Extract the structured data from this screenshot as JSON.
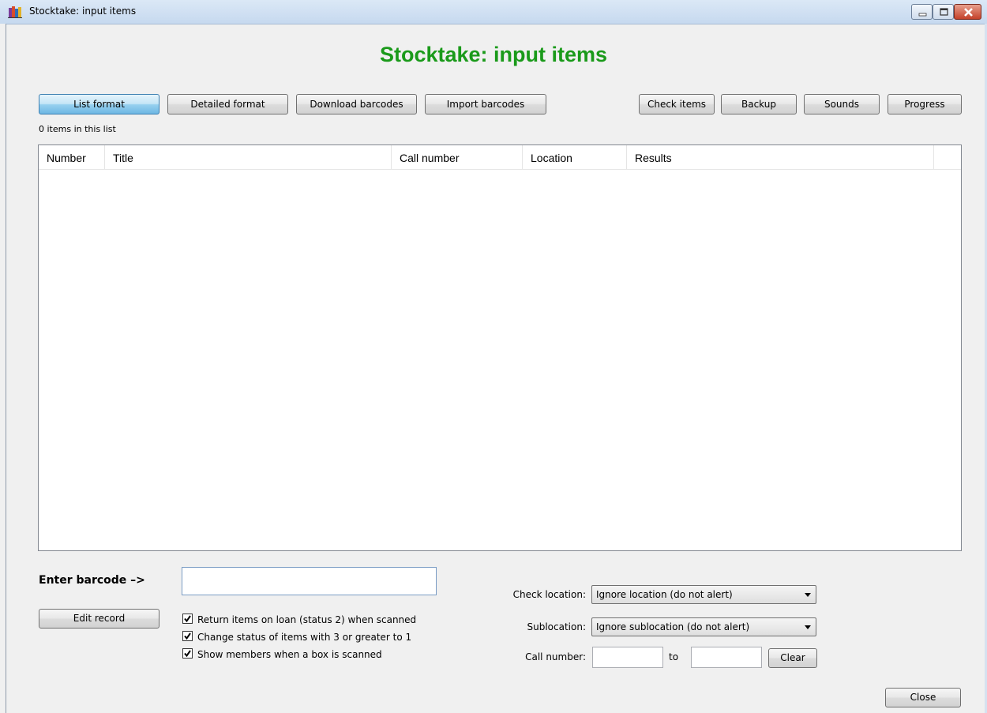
{
  "window": {
    "title": "Stocktake: input items"
  },
  "heading": "Stocktake: input items",
  "toolbar": {
    "list_format": "List format",
    "detailed_format": "Detailed format",
    "download_barcodes": "Download barcodes",
    "import_barcodes": "Import barcodes",
    "check_items": "Check items",
    "backup": "Backup",
    "sounds": "Sounds",
    "progress": "Progress"
  },
  "list": {
    "count_text": "0 items in this list",
    "columns": [
      "Number",
      "Title",
      "Call number",
      "Location",
      "Results"
    ],
    "rows": []
  },
  "barcode": {
    "label": "Enter barcode –>",
    "value": ""
  },
  "edit_record": "Edit record",
  "options": [
    {
      "label": "Return items on loan (status 2) when scanned",
      "checked": true
    },
    {
      "label": "Change status of items with 3 or greater to 1",
      "checked": true
    },
    {
      "label": "Show members when a box is scanned",
      "checked": true
    }
  ],
  "filters": {
    "check_location_label": "Check location:",
    "check_location_value": "Ignore location (do not alert)",
    "sublocation_label": "Sublocation:",
    "sublocation_value": "Ignore sublocation (do not alert)",
    "call_number_label": "Call number:",
    "call_from": "",
    "to_label": "to",
    "call_to": "",
    "clear": "Clear"
  },
  "close": "Close",
  "colors": {
    "heading": "#1a9a1a",
    "active_button": "#98d1ef"
  }
}
